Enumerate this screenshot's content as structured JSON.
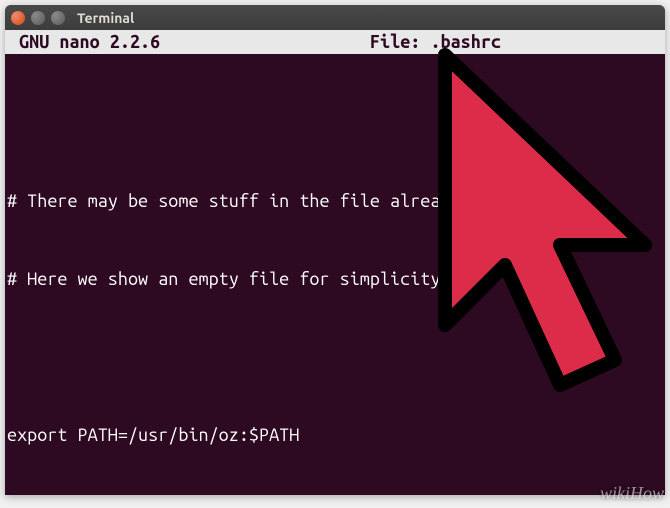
{
  "window": {
    "title": "Terminal"
  },
  "nano": {
    "app_label": " GNU nano 2.2.6",
    "file_prefix": "File: ",
    "filename": ".bashrc"
  },
  "content": {
    "line1": "# There may be some stuff in the file already.",
    "line2": "# Here we show an empty file for simplicity.",
    "line3": "export PATH=/usr/bin/oz:$PATH"
  },
  "icons": {
    "close": "close-icon",
    "minimize": "minimize-icon",
    "maximize": "maximize-icon",
    "cursor": "cursor-arrow-icon"
  },
  "watermark": {
    "text": "wikiHow"
  },
  "colors": {
    "terminal_bg": "#2d0922",
    "text": "#ffffff",
    "header_bg": "#e8e8e8",
    "cursor_fill": "#dd2c4a",
    "cursor_stroke": "#000000"
  }
}
